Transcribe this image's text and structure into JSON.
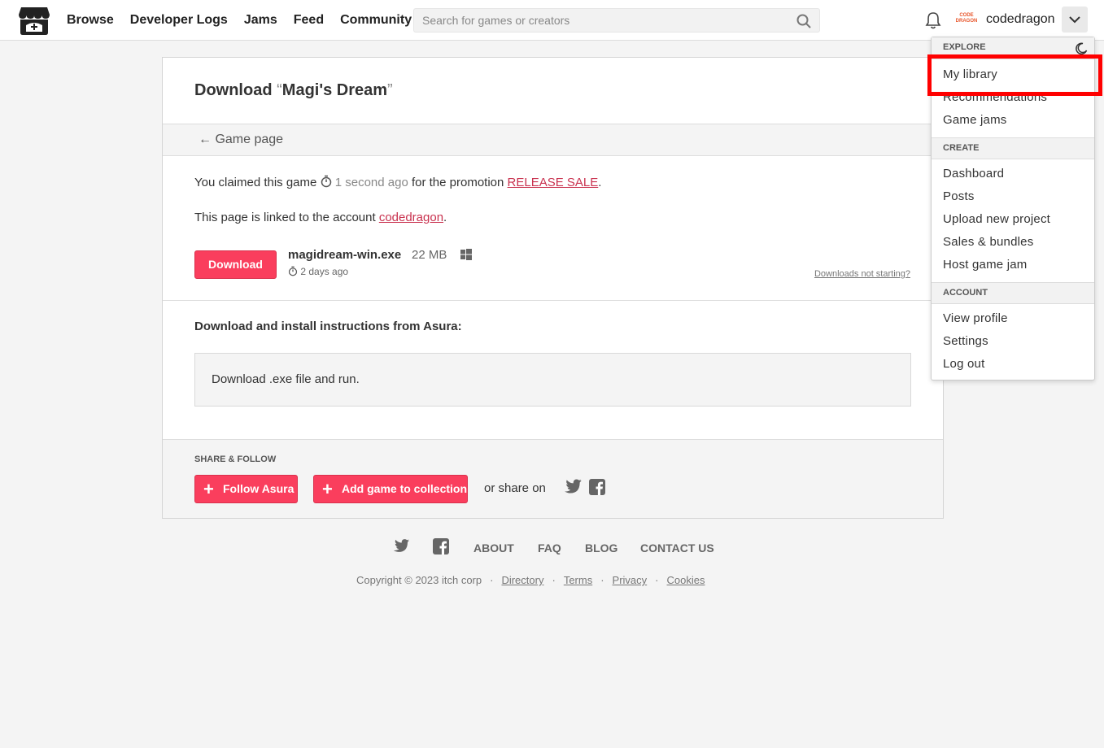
{
  "header": {
    "nav": [
      "Browse",
      "Developer Logs",
      "Jams",
      "Feed",
      "Community"
    ],
    "search_placeholder": "Search for games or creators",
    "username": "codedragon",
    "avatar_text": "CODE DRAGON"
  },
  "page": {
    "title_prefix": "Download",
    "open_quote": "“",
    "game_name": "Magi's Dream",
    "close_quote": "”",
    "back_label": "← Game page",
    "claimed_prefix": "You claimed this game",
    "claimed_time": "1 second ago",
    "claimed_mid": "for the promotion",
    "promotion": "RELEASE SALE",
    "linked_prefix": "This page is linked to the account",
    "linked_account": "codedragon",
    "download_label": "Download",
    "file_name": "magidream-win.exe",
    "file_size": "22 MB",
    "file_date": "2 days ago",
    "not_starting": "Downloads not starting?",
    "instructions_title": "Download and install instructions from Asura:",
    "instructions_text": "Download .exe file and run.",
    "share_title": "SHARE & FOLLOW",
    "follow_label": "Follow Asura",
    "collection_label": "Add game to collection",
    "share_on": "or share on"
  },
  "footer": {
    "links": [
      "ABOUT",
      "FAQ",
      "BLOG",
      "CONTACT US"
    ],
    "copyright": "Copyright © 2023 itch corp",
    "legal": [
      "Directory",
      "Terms",
      "Privacy",
      "Cookies"
    ]
  },
  "dropdown": {
    "explore": "EXPLORE",
    "explore_items": [
      "My library",
      "Recommendations",
      "Game jams"
    ],
    "create": "CREATE",
    "create_items": [
      "Dashboard",
      "Posts",
      "Upload new project",
      "Sales & bundles",
      "Host game jam"
    ],
    "account": "ACCOUNT",
    "account_items": [
      "View profile",
      "Settings",
      "Log out"
    ]
  },
  "colors": {
    "accent": "#fa3e5d",
    "link_red": "#c9324f",
    "highlight": "#ff0000"
  }
}
